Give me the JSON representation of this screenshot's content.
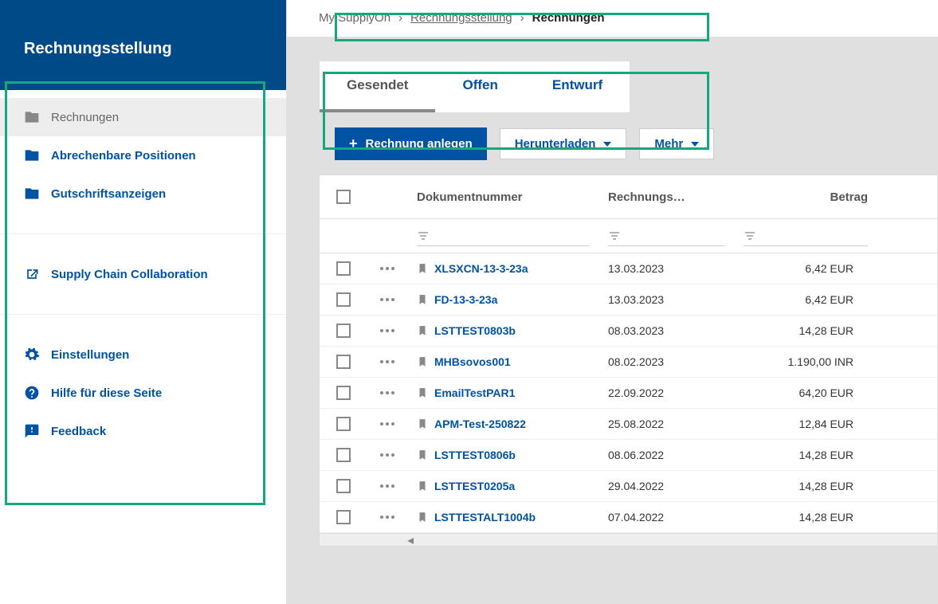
{
  "sidebar": {
    "title": "Rechnungsstellung",
    "nav1": [
      {
        "label": "Rechnungen",
        "icon": "folder"
      },
      {
        "label": "Abrechenbare Positionen",
        "icon": "folder"
      },
      {
        "label": "Gutschriftsanzeigen",
        "icon": "folder"
      }
    ],
    "nav2": [
      {
        "label": "Supply Chain Collaboration",
        "icon": "external"
      }
    ],
    "nav3": [
      {
        "label": "Einstellungen",
        "icon": "gear"
      },
      {
        "label": "Hilfe für diese Seite",
        "icon": "help"
      },
      {
        "label": "Feedback",
        "icon": "feedback"
      }
    ]
  },
  "breadcrumb": {
    "root": "My SupplyOn",
    "mid": "Rechnungsstellung",
    "current": "Rechnungen"
  },
  "tabs": {
    "t0": "Gesendet",
    "t1": "Offen",
    "t2": "Entwurf"
  },
  "toolbar": {
    "create": "Rechnung anlegen",
    "download": "Herunterladen",
    "more": "Mehr"
  },
  "table": {
    "headers": {
      "doc": "Dokumentnummer",
      "date": "Rechnungs…",
      "amount": "Betrag"
    },
    "rows": [
      {
        "doc": "XLSXCN-13-3-23a",
        "date": "13.03.2023",
        "amount": "6,42 EUR"
      },
      {
        "doc": "FD-13-3-23a",
        "date": "13.03.2023",
        "amount": "6,42 EUR"
      },
      {
        "doc": "LSTTEST0803b",
        "date": "08.03.2023",
        "amount": "14,28 EUR"
      },
      {
        "doc": "MHBsovos001",
        "date": "08.02.2023",
        "amount": "1.190,00 INR"
      },
      {
        "doc": "EmailTestPAR1",
        "date": "22.09.2022",
        "amount": "64,20 EUR"
      },
      {
        "doc": "APM-Test-250822",
        "date": "25.08.2022",
        "amount": "12,84 EUR"
      },
      {
        "doc": "LSTTEST0806b",
        "date": "08.06.2022",
        "amount": "14,28 EUR"
      },
      {
        "doc": "LSTTEST0205a",
        "date": "29.04.2022",
        "amount": "14,28 EUR"
      },
      {
        "doc": "LSTTESTALT1004b",
        "date": "07.04.2022",
        "amount": "14,28 EUR"
      }
    ]
  }
}
